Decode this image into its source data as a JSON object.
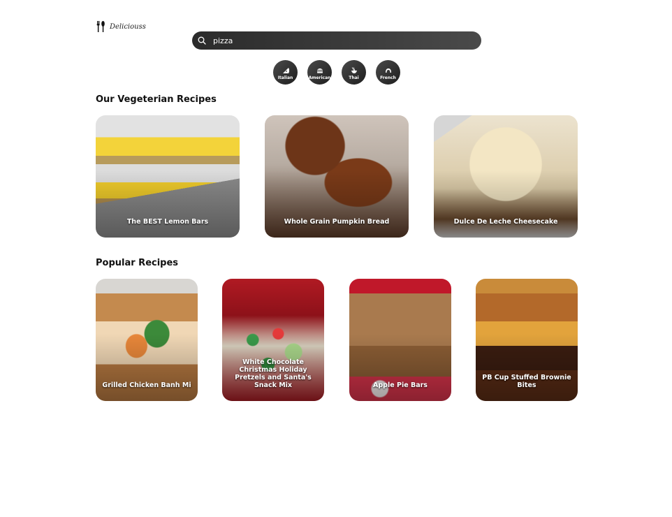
{
  "header": {
    "logo_text": "Deliciouss",
    "logo_icon": "utensils-icon"
  },
  "search": {
    "value": "pizza",
    "icon": "search-icon"
  },
  "categories": [
    {
      "label": "Italian",
      "icon": "pizza-icon"
    },
    {
      "label": "American",
      "icon": "burger-icon"
    },
    {
      "label": "Thai",
      "icon": "noodles-icon"
    },
    {
      "label": "French",
      "icon": "croissant-icon"
    }
  ],
  "vegetarian": {
    "title": "Our Vegeterian Recipes",
    "recipes": [
      {
        "title": "The BEST Lemon Bars"
      },
      {
        "title": "Whole Grain Pumpkin Bread"
      },
      {
        "title": "Dulce De Leche Cheesecake"
      }
    ]
  },
  "popular": {
    "title": "Popular Recipes",
    "recipes": [
      {
        "title": "Grilled Chicken Banh Mi"
      },
      {
        "title": "White Chocolate Christmas Holiday Pretzels and Santa's Snack Mix"
      },
      {
        "title": "Apple Pie Bars"
      },
      {
        "title": "PB Cup Stuffed Brownie Bites"
      }
    ]
  }
}
